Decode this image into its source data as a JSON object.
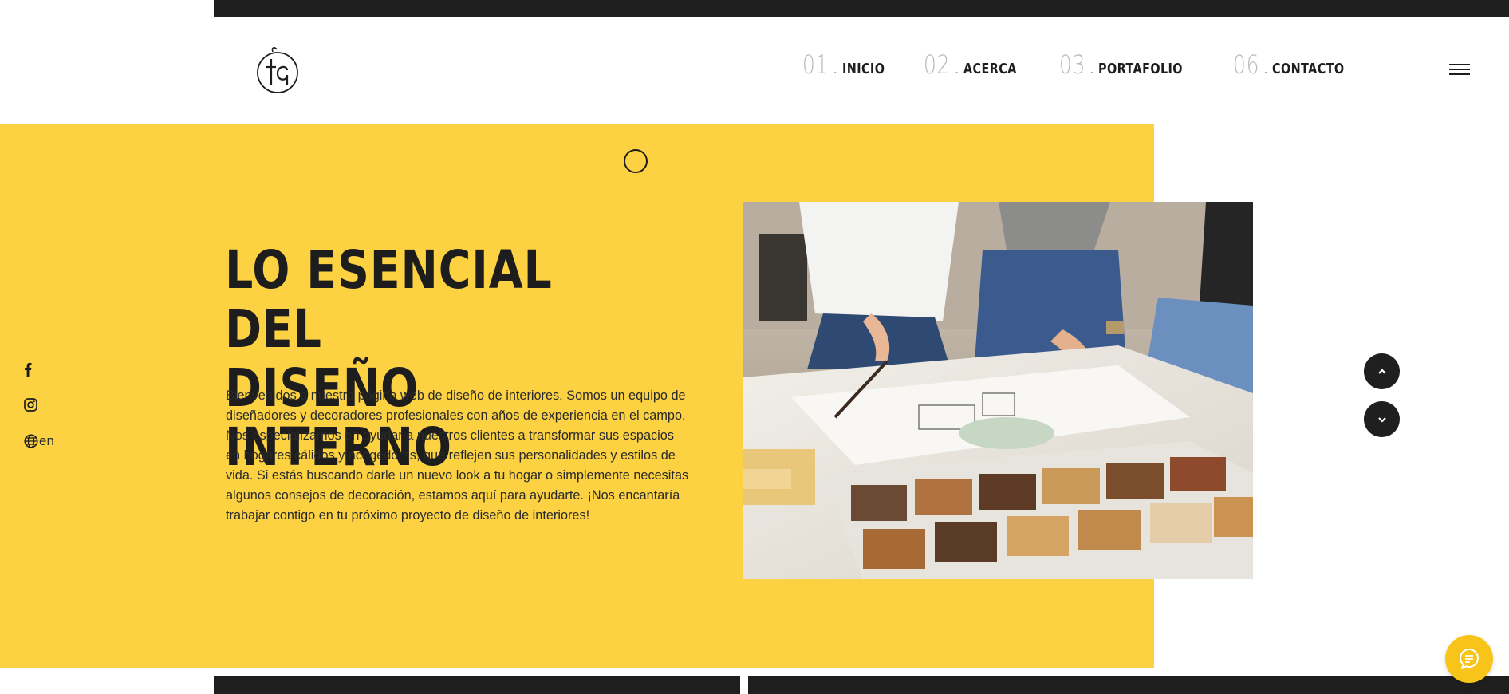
{
  "brand": {
    "logo_icon": "ta-monogram-logo"
  },
  "nav": {
    "items": [
      {
        "num": "01",
        "label": "INICIO"
      },
      {
        "num": "02",
        "label": "ACERCA"
      },
      {
        "num": "03",
        "label": "PORTAFOLIO"
      },
      {
        "num": "06",
        "label": "CONTACTO"
      }
    ],
    "menu_icon": "hamburger-menu-icon"
  },
  "hero": {
    "title_line1": "LO ESENCIAL DEL",
    "title_line2": "DISEÑO INTERNO",
    "text": "Bienvenidos a nuestra página web de diseño de interiores. Somos un equipo de diseñadores y decoradores profesionales con años de experiencia en el campo. Nos especializamos en ayudar a nuestros clientes a transformar sus espacios en hogares cálidos y acogedores, que reflejen sus personalidades y estilos de vida. Si estás buscando darle un nuevo look a tu hogar o simplemente necesitas algunos consejos de decoración, estamos aquí para ayudarte. ¡Nos encantaría trabajar contigo en tu próximo proyecto de diseño de interiores!",
    "accent_color": "#fcd243"
  },
  "social": {
    "facebook_icon": "facebook-icon",
    "instagram_icon": "instagram-icon",
    "language_icon": "globe-icon",
    "language_label": "en"
  },
  "chat": {
    "icon": "chat-bubble-icon",
    "color": "#f8c41a"
  }
}
